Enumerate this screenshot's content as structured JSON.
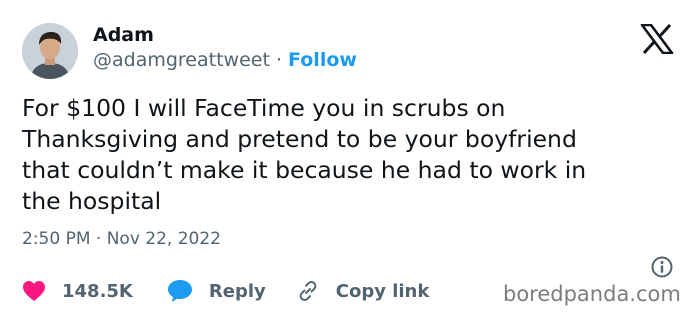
{
  "author": {
    "name": "Adam",
    "handle": "@adamgreattweet",
    "separator": " · ",
    "follow_label": "Follow"
  },
  "tweet": {
    "text": "For $100 I will FaceTime you in scrubs on\nThanksgiving and pretend to be your boyfriend\nthat couldn’t make it because he had to work in\nthe hospital",
    "timestamp": "2:50 PM · Nov 22, 2022"
  },
  "actions": {
    "likes": "148.5K",
    "reply_label": "Reply",
    "copy_link_label": "Copy link"
  },
  "watermark": "boredpanda.com",
  "icons": {
    "logo": "x-logo-icon",
    "like": "heart-icon",
    "reply": "speech-bubble-icon",
    "copy_link": "link-icon",
    "info": "info-icon"
  },
  "colors": {
    "follow": "#1d9bf0",
    "like": "#f91880",
    "reply": "#1d9bf0",
    "secondary_text": "#536471",
    "text": "#0f1419"
  }
}
